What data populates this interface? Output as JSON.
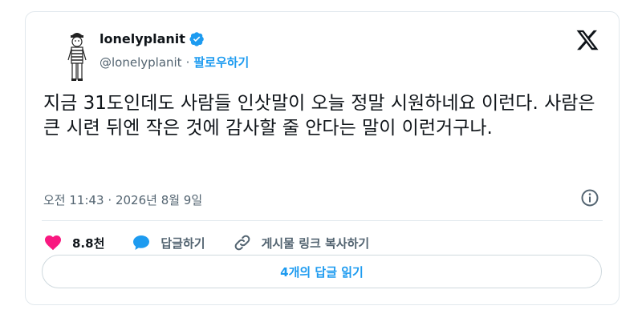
{
  "user": {
    "display_name": "lonelyplanit",
    "handle": "@lonelyplanit",
    "separator": "·",
    "follow_label": "팔로우하기",
    "verified_icon": "verified-badge-icon"
  },
  "tweet": {
    "text": "지금 31도인데도 사람들 인삿말이 오늘 정말 시원하네요 이런다. 사람은 큰 시련 뒤엔 작은 것에 감사할 줄 안다는 말이 이런거구나.",
    "time": "오전 11:43",
    "date": "2026년 8월 9일",
    "meta_separator": "·"
  },
  "actions": {
    "like_count": "8.8천",
    "reply_label": "답글하기",
    "copy_link_label": "게시물 링크 복사하기"
  },
  "read_replies_label": "4개의 답글 읽기",
  "colors": {
    "accent": "#1d9bf0",
    "heart": "#f91880",
    "text": "#0f1419",
    "muted": "#536471",
    "border": "#e1e8ed"
  }
}
